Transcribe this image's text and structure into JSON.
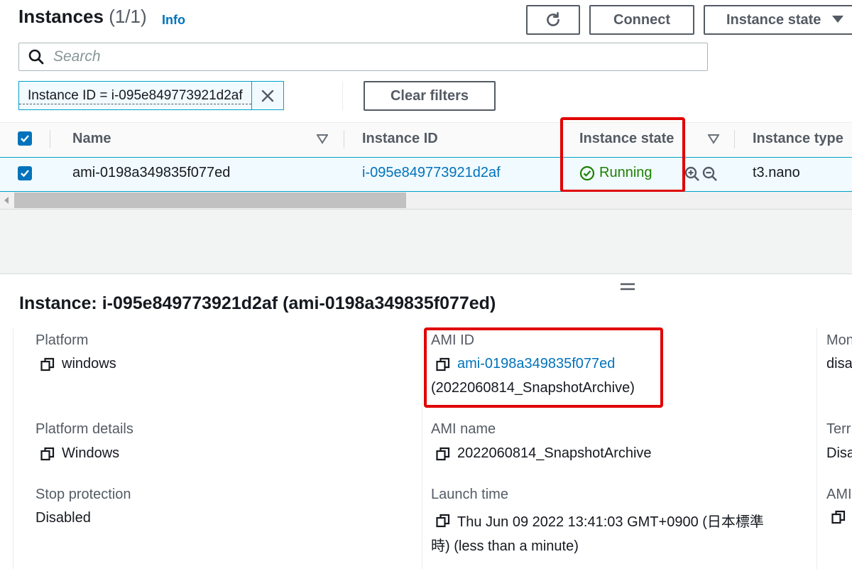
{
  "header": {
    "title": "Instances",
    "count": "(1/1)",
    "info": "Info",
    "connect": "Connect",
    "instance_state": "Instance state"
  },
  "search": {
    "placeholder": "Search"
  },
  "filter": {
    "token": "Instance ID = i-095e849773921d2af",
    "clear": "Clear filters"
  },
  "table": {
    "columns": [
      "Name",
      "Instance ID",
      "Instance state",
      "Instance type"
    ],
    "row": {
      "name": "ami-0198a349835f077ed",
      "instance_id": "i-095e849773921d2af",
      "state": "Running",
      "type": "t3.nano"
    }
  },
  "details": {
    "title": "Instance: i-095e849773921d2af (ami-0198a349835f077ed)",
    "platform_label": "Platform",
    "platform_value": "windows",
    "platform_details_label": "Platform details",
    "platform_details_value": "Windows",
    "stop_protection_label": "Stop protection",
    "stop_protection_value": "Disabled",
    "ami_id_label": "AMI ID",
    "ami_id_value": "ami-0198a349835f077ed",
    "ami_id_value2": "(2022060814_SnapshotArchive)",
    "ami_name_label": "AMI name",
    "ami_name_value": "2022060814_SnapshotArchive",
    "launch_time_label": "Launch time",
    "launch_time_value": "Thu Jun 09 2022 13:41:03 GMT+0900 (日本標準",
    "launch_time_value2": "時) (less than a minute)",
    "col3_label1": "Mon",
    "col3_value1": "disa",
    "col3_label2": "Terr",
    "col3_value2": "Disa",
    "col3_label3": "AMI"
  },
  "colors": {
    "link": "#0073bb",
    "running": "#1d8102",
    "highlight": "#e00000"
  }
}
